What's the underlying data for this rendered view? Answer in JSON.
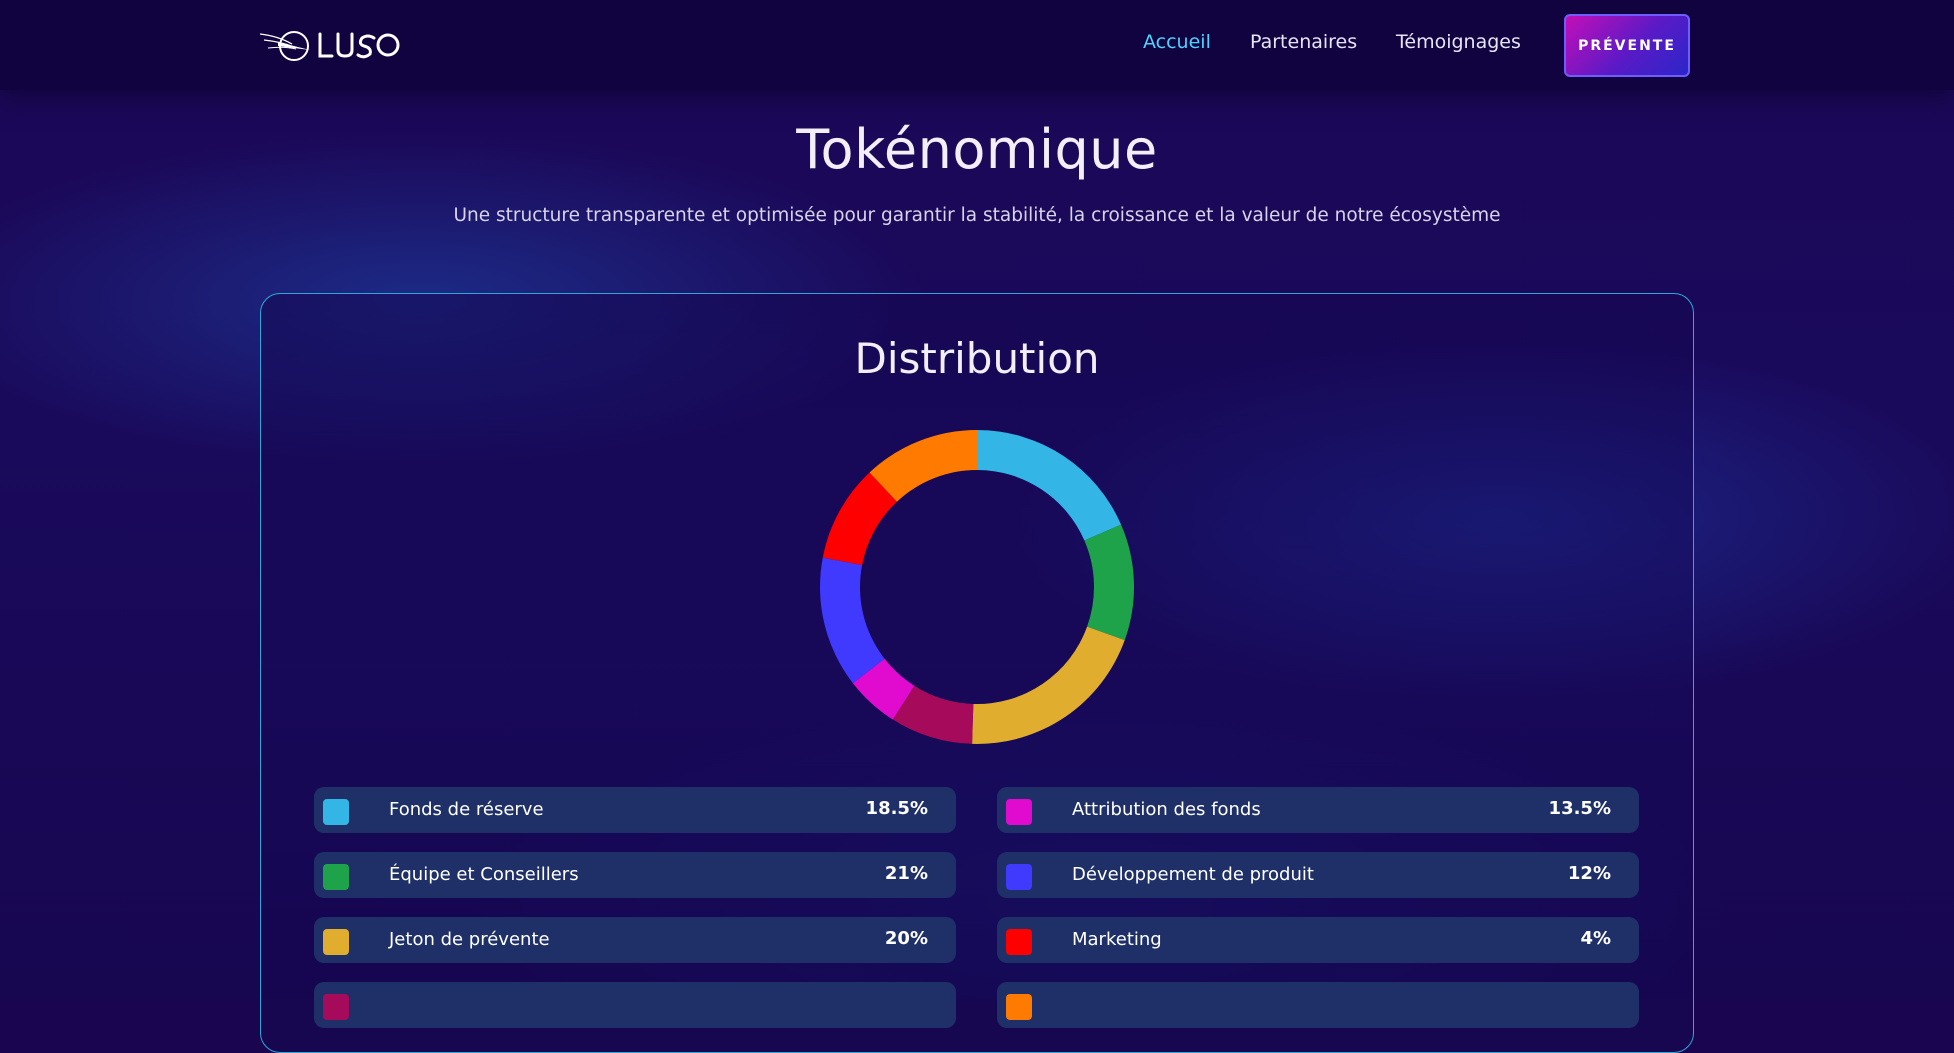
{
  "navbar": {
    "logo_text": "LUSO",
    "links": [
      "Accueil",
      "Partenaires",
      "Témoignages"
    ],
    "active_link": "Accueil",
    "active_color": "#4ed2ff",
    "presale_label": "PRÉVENTE"
  },
  "header": {
    "title": "Tokénomique",
    "subtitle": "Une structure transparente et optimisée pour garantir la stabilité, la croissance et la valeur de notre écosystème"
  },
  "distribution": {
    "title": "Distribution",
    "legend": [
      {
        "label": "Fonds de réserve",
        "value": "18.5%",
        "color": "#33b5e5"
      },
      {
        "label": "Attribution des fonds",
        "value": "13.5%",
        "color": "#e10bd0"
      },
      {
        "label": "Équipe et Conseillers",
        "value": "21%",
        "color": "#1ea34b"
      },
      {
        "label": "Développement de produit",
        "value": "12%",
        "color": "#4039ff"
      },
      {
        "label": "Jeton de prévente",
        "value": "20%",
        "color": "#e0ad2f"
      },
      {
        "label": "Marketing",
        "value": "4%",
        "color": "#ff0000"
      },
      {
        "label": "",
        "value": "",
        "color": "#a50b5a"
      },
      {
        "label": "",
        "value": "",
        "color": "#ff7a00"
      }
    ]
  },
  "chart_data": {
    "type": "pie",
    "title": "Distribution",
    "slices": [
      {
        "name": "cyan",
        "percent": 18.5,
        "color": "#33b5e5"
      },
      {
        "name": "green",
        "percent": 12,
        "color": "#1ea34b"
      },
      {
        "name": "yellow",
        "percent": 20,
        "color": "#e0ad2f"
      },
      {
        "name": "maroon",
        "percent": 8.5,
        "color": "#a50b5a"
      },
      {
        "name": "magenta",
        "percent": 5.5,
        "color": "#e10bd0"
      },
      {
        "name": "blue",
        "percent": 13.5,
        "color": "#4039ff"
      },
      {
        "name": "red",
        "percent": 10,
        "color": "#ff0000"
      },
      {
        "name": "orange",
        "percent": 12,
        "color": "#ff7a00"
      }
    ]
  }
}
